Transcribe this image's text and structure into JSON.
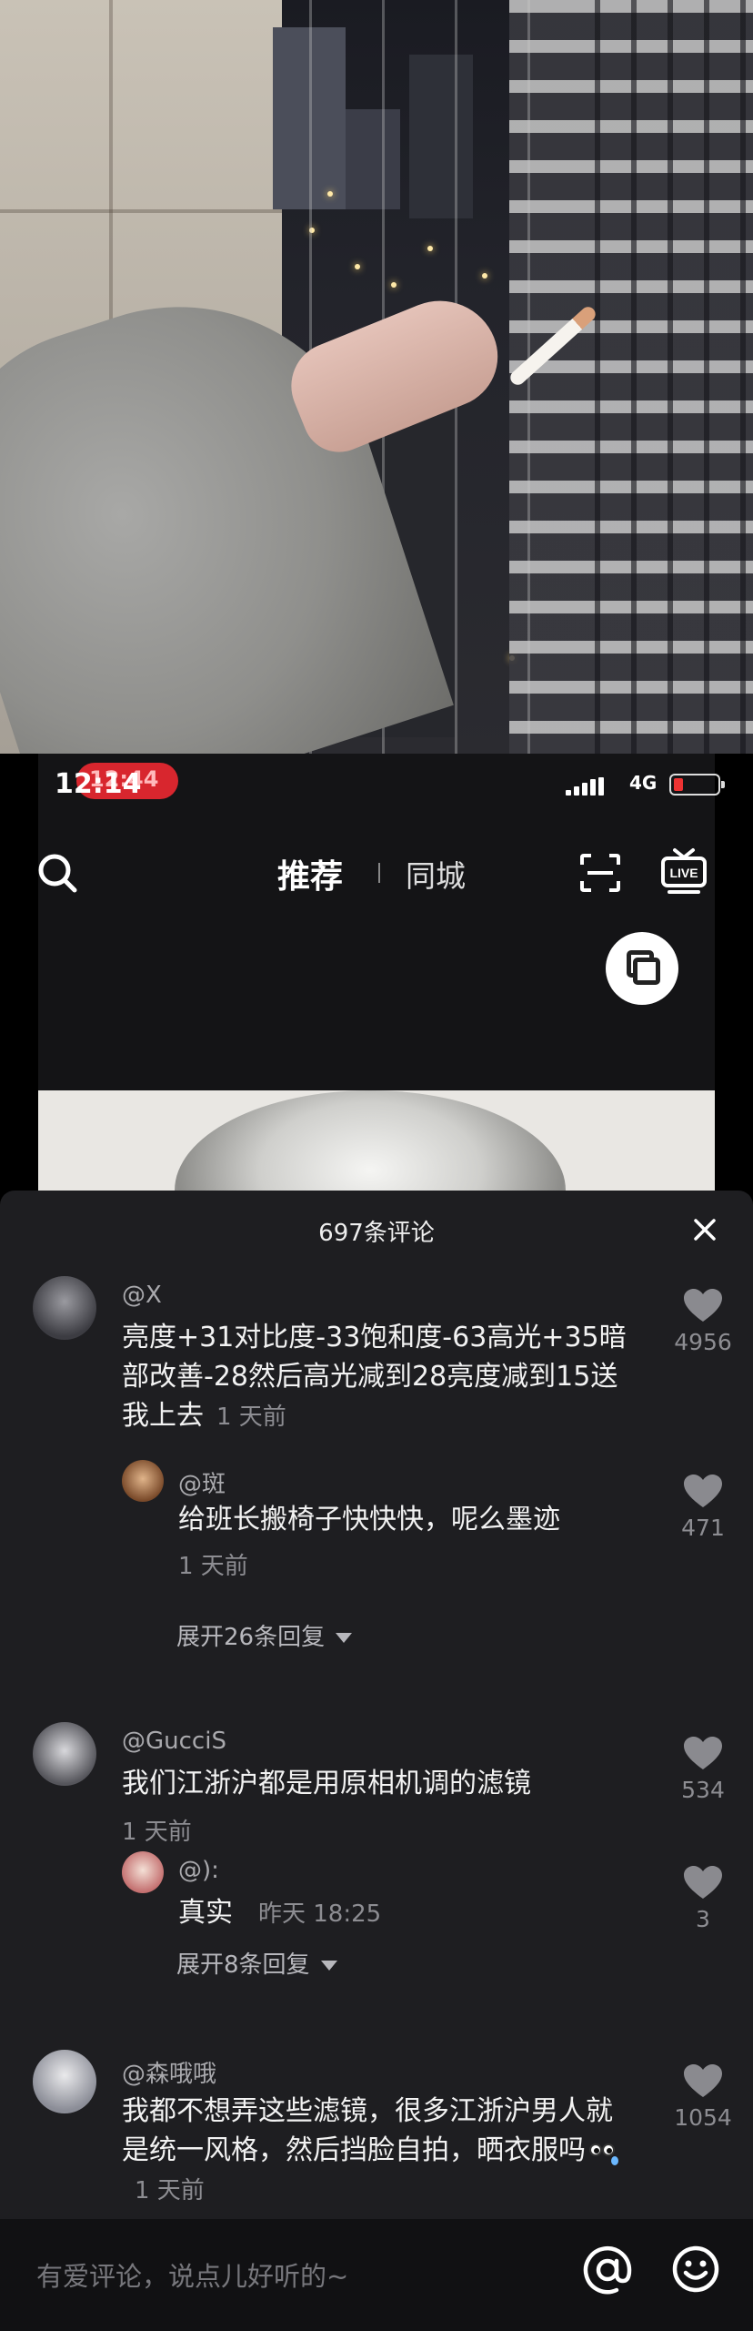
{
  "status_bar": {
    "time": "12:14",
    "overlay_time": "12:44",
    "network": "4G"
  },
  "top_nav": {
    "tab_recommend": "推荐",
    "tab_local": "同城",
    "icons": [
      "search-icon",
      "scan-icon",
      "live-icon"
    ]
  },
  "comments_panel": {
    "count_title": "697条评论",
    "comments": [
      {
        "user": "@X",
        "text": "亮度+31对比度-33饱和度-63高光+35暗部改善-28然后高光减到28亮度减到15送我上去",
        "time": "1 天前",
        "likes": "4956",
        "reply": {
          "user": "@斑",
          "text": "给班长搬椅子快快快，呢么墨迹",
          "time": "1 天前",
          "likes": "471"
        },
        "expand": "展开26条回复"
      },
      {
        "user": "@GucciS",
        "text": "我们江浙沪都是用原相机调的滤镜",
        "time": "1 天前",
        "likes": "534",
        "reply": {
          "user": "@):",
          "text": "真实",
          "time": "昨天 18:25",
          "likes": "3"
        },
        "expand": "展开8条回复"
      },
      {
        "user": "@森哦哦",
        "text": "我都不想弄这些滤镜，很多江浙沪男人就是统一风格，然后挡脸自拍，晒衣服吗",
        "time": "1 天前",
        "likes": "1054"
      }
    ]
  },
  "input_bar": {
    "placeholder": "有爱评论，说点儿好听的~"
  },
  "colors": {
    "sheet_bg": "#1e1e21",
    "time_pill": "#d8262e",
    "battery_low": "#ee3333"
  }
}
